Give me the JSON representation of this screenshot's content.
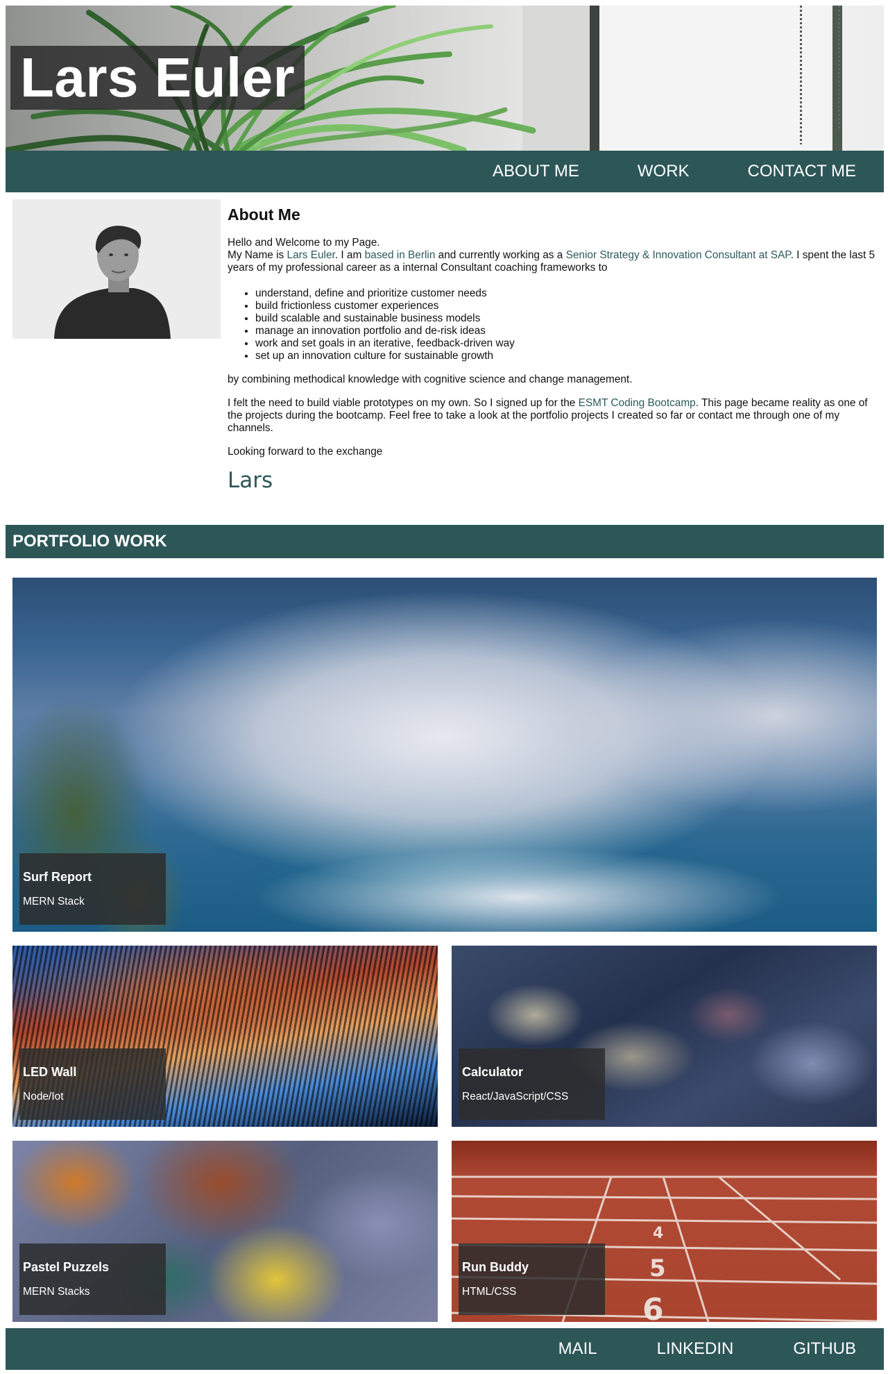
{
  "header": {
    "title": "Lars Euler"
  },
  "nav": {
    "about": "ABOUT ME",
    "work": "WORK",
    "contact": "CONTACT ME"
  },
  "about": {
    "heading": "About Me",
    "greeting": "Hello and Welcome to my Page.",
    "intro_1": "My Name is ",
    "name_link": "Lars Euler",
    "intro_2": ". I am ",
    "location_link": "based in Berlin",
    "intro_3": " and currently working as a ",
    "job_link": "Senior Strategy & Innovation Consultant at SAP",
    "intro_4": ". I spent the last 5 years of my professional career as a internal Consultant coaching frameworks to",
    "bullets": [
      "understand, define and prioritize customer needs",
      "build frictionless customer experiences",
      "build scalable and sustainable business models",
      "manage an innovation portfolio and de-risk ideas",
      "work and set goals in an iterative, feedback-driven way",
      "set up an innovation culture for sustainable growth"
    ],
    "combining": "by combining methodical knowledge with cognitive science and change management.",
    "bootcamp_1": "I felt the need to build viable prototypes on my own. So I signed up for the ",
    "bootcamp_link": "ESMT Coding Bootcamp",
    "bootcamp_2": ". This page became reality as one of the projects during the bootcamp. Feel free to take a look at the portfolio projects I created so far or contact me through one of my channels.",
    "closing": "Looking forward to the exchange",
    "signature": "Lars"
  },
  "portfolio": {
    "heading": "PORTFOLIO WORK",
    "projects": [
      {
        "title": "Surf Report",
        "stack": "MERN Stack"
      },
      {
        "title": "LED Wall",
        "stack": "Node/Iot"
      },
      {
        "title": "Calculator",
        "stack": "React/JavaScript/CSS"
      },
      {
        "title": "Pastel Puzzels",
        "stack": "MERN Stacks"
      },
      {
        "title": "Run Buddy",
        "stack": "HTML/CSS"
      }
    ]
  },
  "footer": {
    "mail": "MAIL",
    "linkedin": "LINKEDIN",
    "github": "GITHUB"
  },
  "colors": {
    "accent": "#2d5657",
    "link": "#2d5a5b",
    "caption_bg": "#2d2d2d"
  }
}
